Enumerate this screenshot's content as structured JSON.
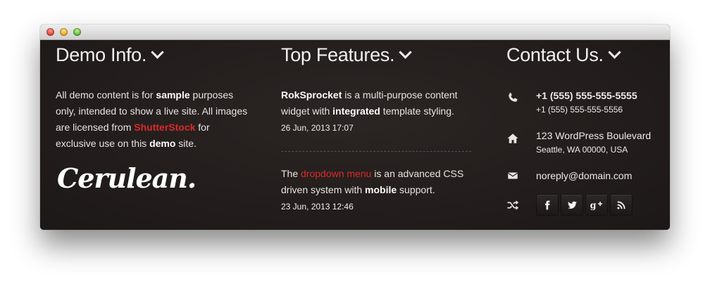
{
  "window": {
    "controls": [
      "close",
      "minimize",
      "zoom"
    ]
  },
  "demo_info": {
    "heading": "Demo Info.",
    "text_1": "All demo content is for ",
    "bold_1": "sample",
    "text_2": " purposes only, intended to show a live site. All images are licensed from ",
    "link": "ShutterStock",
    "text_3": " for exclusive use on this ",
    "bold_2": "demo",
    "text_4": " site.",
    "logo_text": "Cerulean."
  },
  "top_features": {
    "heading": "Top Features.",
    "item1": {
      "bold_1": "RokSprocket",
      "text_1": " is a multi-purpose content widget with ",
      "bold_2": "integrated",
      "text_2": " template styling.",
      "date": "26 Jun, 2013 17:07"
    },
    "item2": {
      "text_1": "The ",
      "link": "dropdown menu",
      "text_2": " is an advanced CSS driven system with ",
      "bold_1": "mobile",
      "text_3": " support.",
      "date": "23 Jun, 2013 12:46"
    }
  },
  "contact": {
    "heading": "Contact Us.",
    "phone_main": "+1 (555) 555-555-5555",
    "phone_alt": "+1 (555) 555-555-5556",
    "address_line1": "123 WordPress Boulevard",
    "address_line2": "Seattle, WA 00000, USA",
    "email": "noreply@domain.com",
    "icons": [
      "phone-icon",
      "home-icon",
      "envelope-icon",
      "shuffle-icon"
    ],
    "social": [
      {
        "name": "facebook",
        "glyph": "f"
      },
      {
        "name": "twitter",
        "glyph": "t"
      },
      {
        "name": "google-plus",
        "glyph": "g+"
      },
      {
        "name": "rss",
        "glyph": "rss"
      }
    ]
  },
  "colors": {
    "background": "#241f1e",
    "accent": "#d92a2a",
    "text": "#e8e4e2"
  }
}
